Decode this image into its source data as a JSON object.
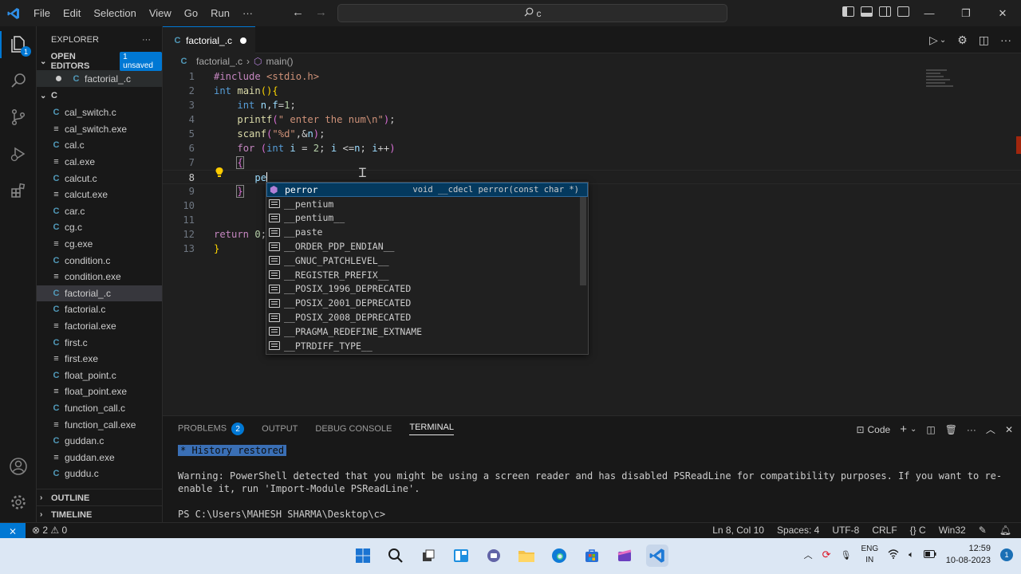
{
  "titlebar": {
    "menu": [
      "File",
      "Edit",
      "Selection",
      "View",
      "Go",
      "Run",
      "···"
    ],
    "search_text": "c"
  },
  "sidebar": {
    "title": "EXPLORER",
    "open_editors_label": "OPEN EDITORS",
    "unsaved_badge": "1 unsaved",
    "open_editor_file": "factorial_.c",
    "folder_label": "C",
    "files": [
      {
        "name": "cal_switch.c",
        "type": "c"
      },
      {
        "name": "cal_switch.exe",
        "type": "exe"
      },
      {
        "name": "cal.c",
        "type": "c"
      },
      {
        "name": "cal.exe",
        "type": "exe"
      },
      {
        "name": "calcut.c",
        "type": "c"
      },
      {
        "name": "calcut.exe",
        "type": "exe"
      },
      {
        "name": "car.c",
        "type": "c"
      },
      {
        "name": "cg.c",
        "type": "c"
      },
      {
        "name": "cg.exe",
        "type": "exe"
      },
      {
        "name": "condition.c",
        "type": "c"
      },
      {
        "name": "condition.exe",
        "type": "exe"
      },
      {
        "name": "factorial_.c",
        "type": "c",
        "selected": true
      },
      {
        "name": "factorial.c",
        "type": "c"
      },
      {
        "name": "factorial.exe",
        "type": "exe"
      },
      {
        "name": "first.c",
        "type": "c"
      },
      {
        "name": "first.exe",
        "type": "exe"
      },
      {
        "name": "float_point.c",
        "type": "c"
      },
      {
        "name": "float_point.exe",
        "type": "exe"
      },
      {
        "name": "function_call.c",
        "type": "c"
      },
      {
        "name": "function_call.exe",
        "type": "exe"
      },
      {
        "name": "guddan.c",
        "type": "c"
      },
      {
        "name": "guddan.exe",
        "type": "exe"
      },
      {
        "name": "guddu.c",
        "type": "c"
      }
    ],
    "outline_label": "OUTLINE",
    "timeline_label": "TIMELINE"
  },
  "editor": {
    "tab_label": "factorial_.c",
    "breadcrumb_file": "factorial_.c",
    "breadcrumb_symbol": "main()",
    "line_numbers": [
      "1",
      "2",
      "3",
      "4",
      "5",
      "6",
      "7",
      "8",
      "9",
      "10",
      "11",
      "12",
      "13"
    ],
    "current_line": 8,
    "typed_text": "pe"
  },
  "suggest": {
    "items": [
      {
        "label": "perror",
        "detail": "void __cdecl perror(const char *)",
        "kind": "function"
      },
      {
        "label": "__pentium",
        "kind": "macro"
      },
      {
        "label": "__pentium__",
        "kind": "macro"
      },
      {
        "label": "__paste",
        "kind": "macro"
      },
      {
        "label": "__ORDER_PDP_ENDIAN__",
        "kind": "macro"
      },
      {
        "label": "__GNUC_PATCHLEVEL__",
        "kind": "macro"
      },
      {
        "label": "__REGISTER_PREFIX__",
        "kind": "macro"
      },
      {
        "label": "__POSIX_1996_DEPRECATED",
        "kind": "macro"
      },
      {
        "label": "__POSIX_2001_DEPRECATED",
        "kind": "macro"
      },
      {
        "label": "__POSIX_2008_DEPRECATED",
        "kind": "macro"
      },
      {
        "label": "__PRAGMA_REDEFINE_EXTNAME",
        "kind": "macro"
      },
      {
        "label": "__PTRDIFF_TYPE__",
        "kind": "macro"
      }
    ]
  },
  "panel": {
    "tabs": {
      "problems": "PROBLEMS",
      "problems_count": "2",
      "output": "OUTPUT",
      "debug": "DEBUG CONSOLE",
      "terminal": "TERMINAL"
    },
    "terminal_profile": "Code",
    "history_restored": "History restored",
    "warning_line1": "Warning: PowerShell detected that you might be using a screen reader and has disabled PSReadLine for compatibility purposes. If you want to re-",
    "warning_line2": "enable it, run 'Import-Module PSReadLine'.",
    "prompt": "PS C:\\Users\\MAHESH SHARMA\\Desktop\\c>"
  },
  "statusbar": {
    "errors": "2",
    "warnings": "0",
    "position": "Ln 8, Col 10",
    "spaces": "Spaces: 4",
    "encoding": "UTF-8",
    "eol": "CRLF",
    "language": "C",
    "platform": "Win32"
  },
  "taskbar": {
    "lang_top": "ENG",
    "lang_bottom": "IN",
    "time": "12:59",
    "date": "10-08-2023",
    "notifications": "1"
  },
  "colors": {
    "accent": "#0078d4",
    "editor_bg": "#1f1f1f",
    "sidebar_bg": "#181818",
    "taskbar_bg": "#dce7f4"
  }
}
